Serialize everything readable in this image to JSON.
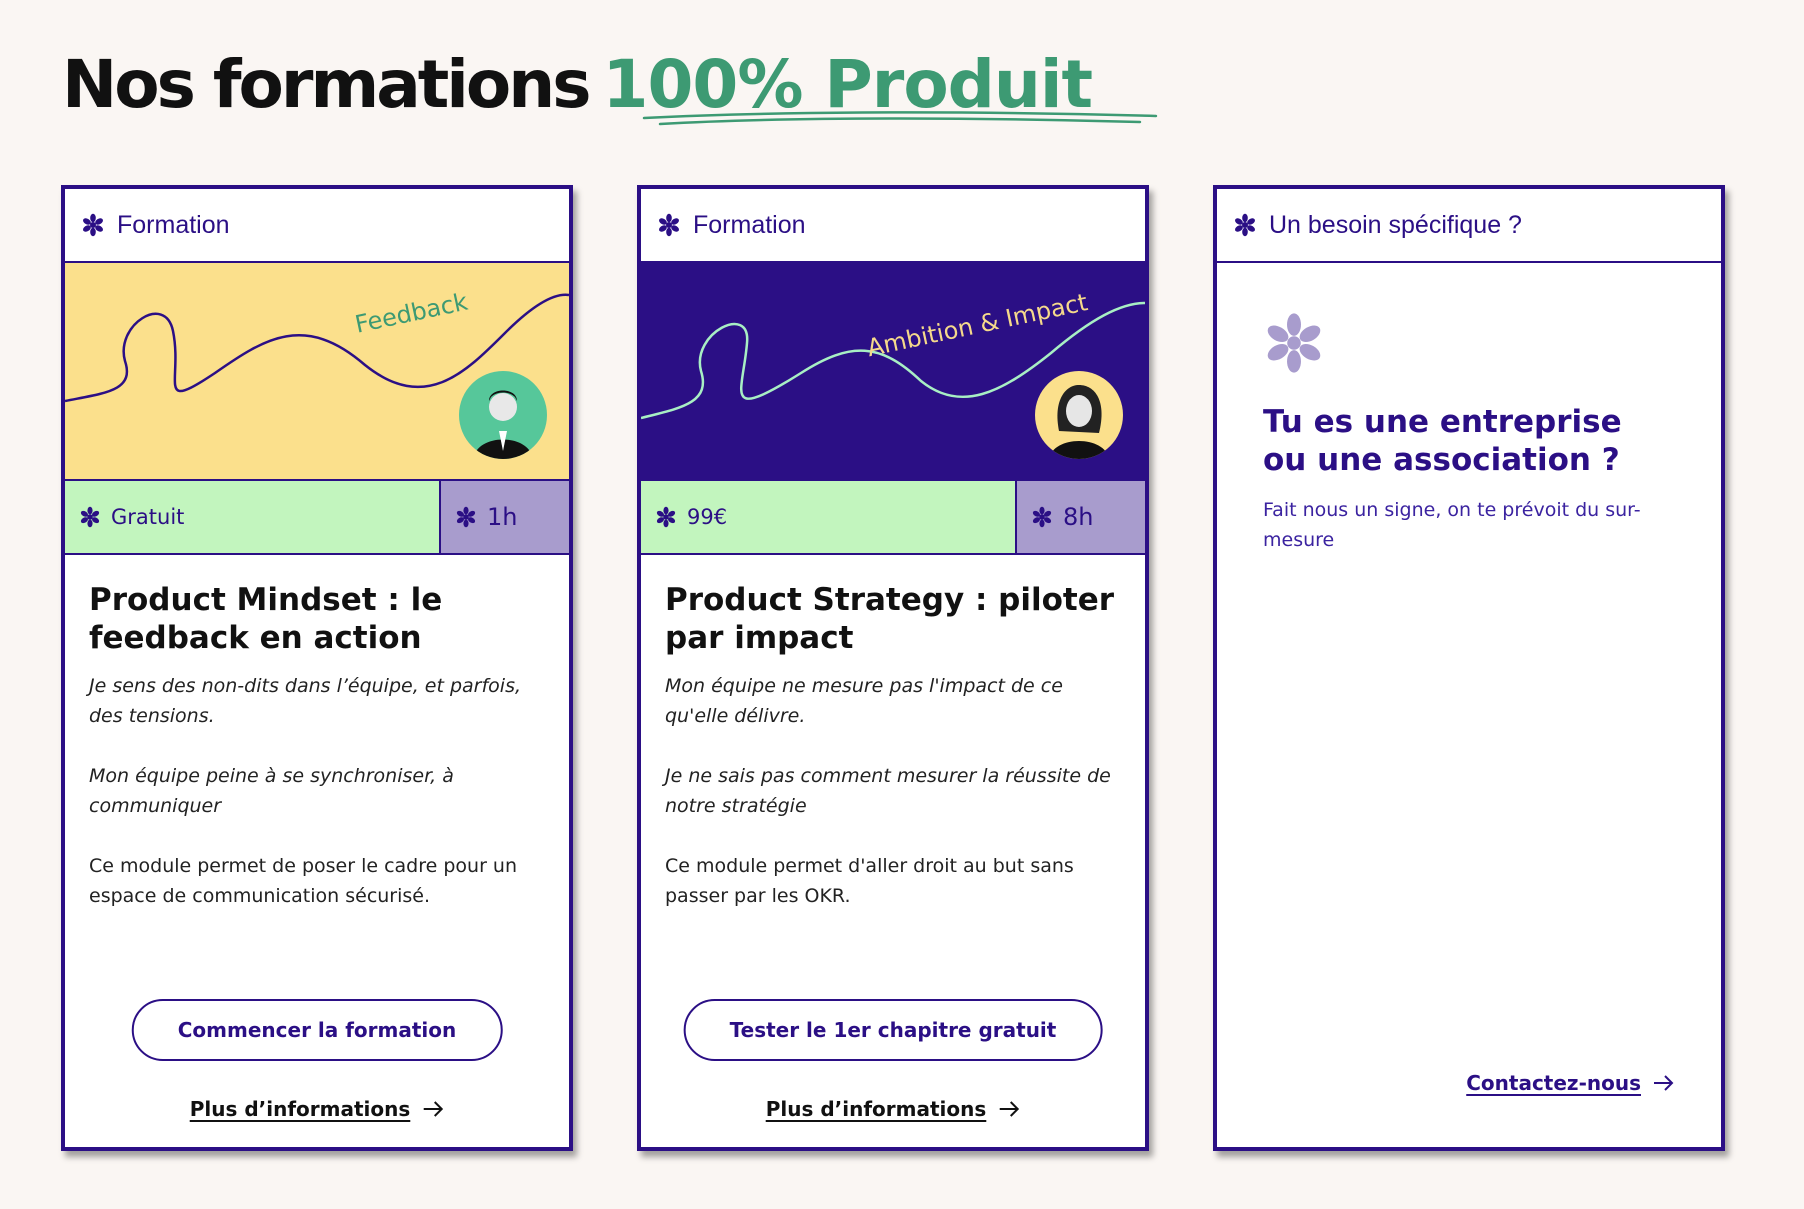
{
  "page": {
    "title_plain": "Nos formations",
    "title_accent": "100% Produit"
  },
  "colors": {
    "primary": "#2b0f85",
    "accent_green": "#3d9a73",
    "price_bg": "#c2f5be",
    "duration_bg": "#a89ccd",
    "banner_yellow": "#fbe08c",
    "banner_purple": "#2b0f85",
    "page_bg": "#faf6f3"
  },
  "cards": [
    {
      "header_label": "Formation",
      "header_icon": "flower-icon",
      "banner_text": "Feedback",
      "price": "Gratuit",
      "duration": "1h",
      "title": "Product Mindset : le feedback en action",
      "italic_1": "Je sens des non-dits dans l’équipe, et parfois, des tensions.",
      "italic_2": "Mon équipe peine à se synchroniser, à communiquer",
      "description": "Ce module permet de poser le cadre pour un espace de communication sécurisé.",
      "cta_label": "Commencer la formation",
      "more_label": "Plus d’informations"
    },
    {
      "header_label": "Formation",
      "header_icon": "flower-icon",
      "banner_text": "Ambition & Impact",
      "price": "99€",
      "duration": "8h",
      "title": "Product Strategy : piloter par impact",
      "italic_1": "Mon équipe ne mesure pas l'impact de ce qu'elle délivre.",
      "italic_2": "Je ne sais pas comment mesurer la réussite de notre stratégie",
      "description": "Ce module permet d'aller droit au but sans passer par les OKR.",
      "cta_label": "Tester le 1er chapitre gratuit",
      "more_label": "Plus d’informations"
    },
    {
      "header_label": "Un besoin spécifique ?",
      "header_icon": "flower-icon",
      "title": "Tu es une entreprise ou une association ?",
      "text": "Fait nous un signe, on te prévoit du sur-mesure",
      "contact_label": "Contactez-nous"
    }
  ]
}
